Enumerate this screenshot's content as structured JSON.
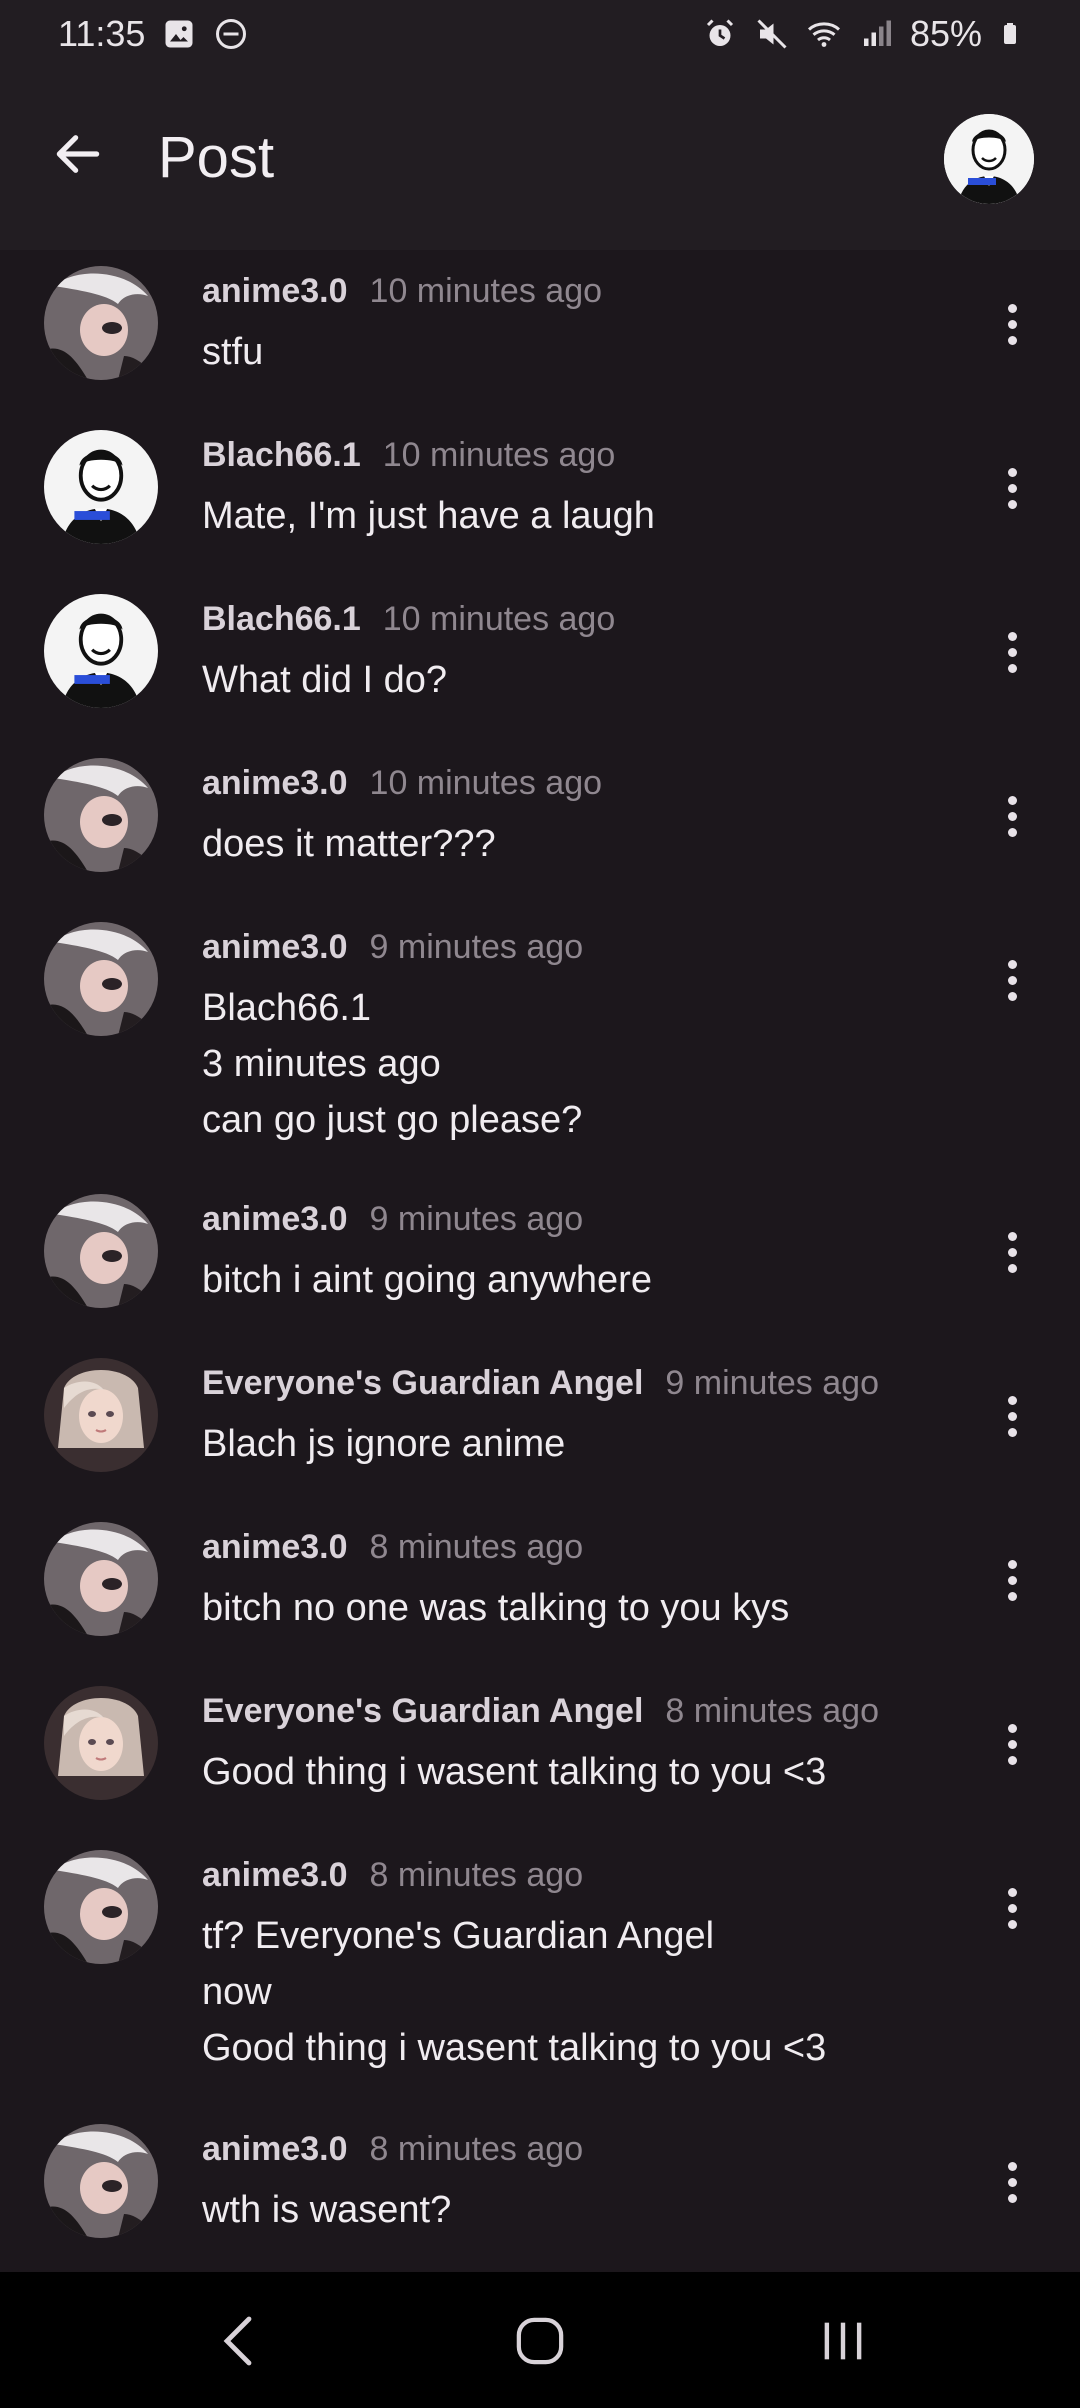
{
  "status_bar": {
    "time": "11:35",
    "battery": "85%",
    "left_icons": [
      "gallery-icon",
      "do-not-disturb-icon"
    ],
    "right_icons": [
      "alarm-icon",
      "mute-icon",
      "wifi-icon",
      "signal-icon",
      "battery-icon"
    ]
  },
  "app_bar": {
    "title": "Post"
  },
  "comments": [
    {
      "author": "anime3.0",
      "time": "10 minutes ago",
      "text": "stfu",
      "avatar": "anime"
    },
    {
      "author": "Blach66.1",
      "time": "10 minutes ago",
      "text": "Mate, I'm just have a laugh",
      "avatar": "blach"
    },
    {
      "author": "Blach66.1",
      "time": "10 minutes ago",
      "text": "What did I do?",
      "avatar": "blach"
    },
    {
      "author": "anime3.0",
      "time": "10 minutes ago",
      "text": "does it matter???",
      "avatar": "anime"
    },
    {
      "author": "anime3.0",
      "time": "9 minutes ago",
      "text": "Blach66.1\n3 minutes ago\ncan go just go please?",
      "avatar": "anime"
    },
    {
      "author": "anime3.0",
      "time": "9 minutes ago",
      "text": "bitch i aint going anywhere",
      "avatar": "anime"
    },
    {
      "author": "Everyone's Guardian Angel",
      "time": "9 minutes ago",
      "text": "Blach js ignore anime",
      "avatar": "angel"
    },
    {
      "author": "anime3.0",
      "time": "8 minutes ago",
      "text": "bitch no one was talking to you kys",
      "avatar": "anime"
    },
    {
      "author": "Everyone's Guardian Angel",
      "time": "8 minutes ago",
      "text": "Good thing i wasent talking to you <3",
      "avatar": "angel"
    },
    {
      "author": "anime3.0",
      "time": "8 minutes ago",
      "text": "tf? Everyone's Guardian Angel\nnow\nGood thing i wasent talking to you <3",
      "avatar": "anime"
    },
    {
      "author": "anime3.0",
      "time": "8 minutes ago",
      "text": "wth is wasent?",
      "avatar": "anime"
    }
  ],
  "nav_bar": {
    "buttons": [
      "back-icon",
      "home-icon",
      "recent-apps-icon"
    ]
  },
  "colors": {
    "background": "#1c171c",
    "app_bar": "#221d22",
    "author": "#d9d2d9",
    "timestamp": "#8f878f"
  }
}
